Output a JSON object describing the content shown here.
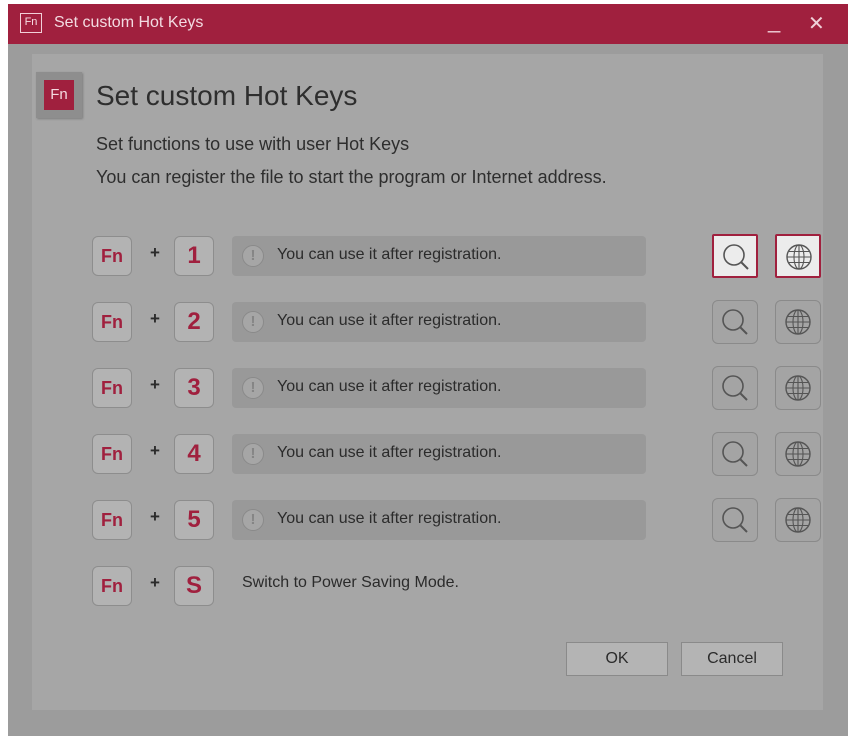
{
  "window": {
    "title": "Set custom Hot Keys",
    "title_icon": "Fn",
    "minimize_glyph": "_",
    "close_glyph": "✕"
  },
  "header": {
    "icon_text": "Fn",
    "title": "Set custom Hot Keys",
    "desc_line1": "Set functions to use with user Hot Keys",
    "desc_line2": "You can register the file to start the program or Internet address."
  },
  "plus": "+",
  "rows": [
    {
      "fn": "Fn",
      "key": "1",
      "warn": "!",
      "text": "You can use it after registration."
    },
    {
      "fn": "Fn",
      "key": "2",
      "warn": "!",
      "text": "You can use it after registration."
    },
    {
      "fn": "Fn",
      "key": "3",
      "warn": "!",
      "text": "You can use it after registration."
    },
    {
      "fn": "Fn",
      "key": "4",
      "warn": "!",
      "text": "You can use it after registration."
    },
    {
      "fn": "Fn",
      "key": "5",
      "warn": "!",
      "text": "You can use it after registration."
    }
  ],
  "power_row": {
    "fn": "Fn",
    "key": "S",
    "text": "Switch to Power Saving Mode."
  },
  "buttons": {
    "ok": "OK",
    "cancel": "Cancel"
  },
  "colors": {
    "accent": "#a0203e",
    "overlay_gray": "#9c9c9c"
  }
}
